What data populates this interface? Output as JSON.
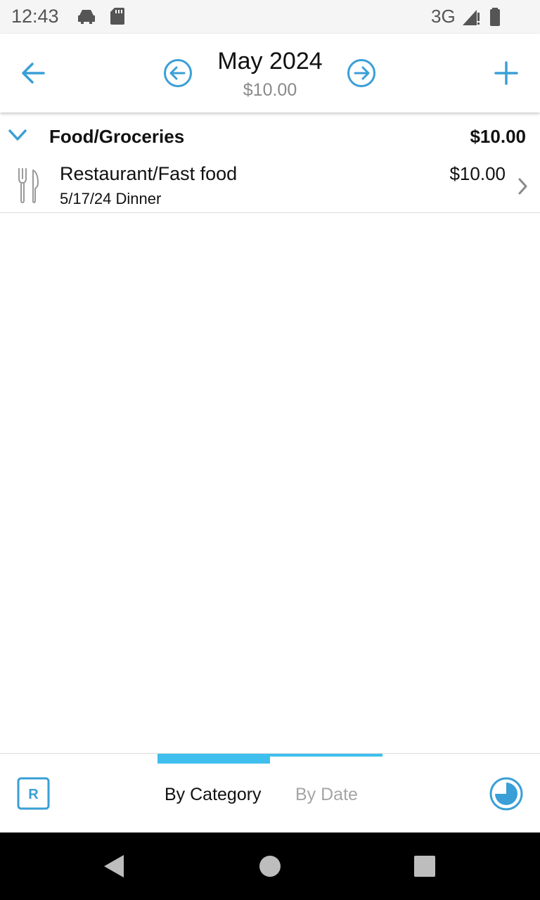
{
  "status_bar": {
    "time": "12:43",
    "network": "3G",
    "icons": [
      "car-icon",
      "sd-card-icon",
      "signal-icon",
      "battery-icon"
    ]
  },
  "header": {
    "back_icon": "arrow-left-icon",
    "prev_icon": "circle-arrow-left-icon",
    "next_icon": "circle-arrow-right-icon",
    "add_icon": "plus-icon",
    "month": "May 2024",
    "total": "$10.00"
  },
  "categories": [
    {
      "name": "Food/Groceries",
      "total": "$10.00",
      "expanded": true,
      "transactions": [
        {
          "icon": "fork-knife-icon",
          "name": "Restaurant/Fast food",
          "details": "5/17/24 Dinner",
          "amount": "$10.00"
        }
      ]
    }
  ],
  "bottom_bar": {
    "left_icon": "recurring-r-icon",
    "right_icon": "pie-chart-icon",
    "tabs": [
      {
        "label": "By Category",
        "active": true
      },
      {
        "label": "By Date",
        "active": false
      }
    ]
  },
  "colors": {
    "accent": "#3a9fd6",
    "tab_indicator": "#3fbfee",
    "muted_text": "#8a8a8a"
  }
}
